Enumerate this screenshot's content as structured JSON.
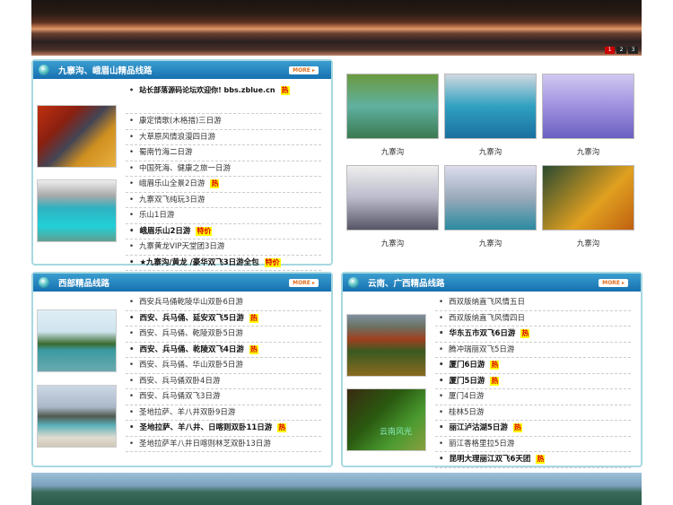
{
  "banner": {
    "pages": [
      "1",
      "2",
      "3"
    ]
  },
  "more_label": "MORE ▸",
  "hot": "热",
  "special": "特价",
  "panel1": {
    "title": "九寨沟、峨眉山精品线路",
    "items": [
      {
        "text": "站长部落源码论坛欢迎你! bbs.zblue.cn",
        "bold": true,
        "tag": "hot"
      },
      {
        "text": "康定情歌(木格措)三日游"
      },
      {
        "text": "大草原风情浪漫四日游"
      },
      {
        "text": "蜀南竹海二日游"
      },
      {
        "text": "中国死海、健康之旅一日游"
      },
      {
        "text": "峨眉乐山全景2日游",
        "tag": "hot"
      },
      {
        "text": "九寨双飞纯玩3日游"
      },
      {
        "text": "乐山1日游"
      },
      {
        "text": "峨眉乐山2日游",
        "bold": true,
        "tag": "special"
      },
      {
        "text": "九寨黄龙VIP天堂团3日游"
      },
      {
        "text": "★九寨沟/黄龙 /豪华双飞3日游全包",
        "bold": true,
        "tag": "special"
      }
    ]
  },
  "gallery": [
    "九寨沟",
    "九寨沟",
    "九寨沟",
    "九寨沟",
    "九寨沟",
    "九寨沟"
  ],
  "panel2": {
    "title": "西部精品线路",
    "items": [
      {
        "text": "西安兵马俑乾陵华山双卧6日游"
      },
      {
        "text": "西安、兵马俑、延安双飞5日游",
        "bold": true,
        "tag": "hot"
      },
      {
        "text": "西安、兵马俑、乾陵双卧5日游"
      },
      {
        "text": "西安、兵马俑、乾陵双飞4日游",
        "bold": true,
        "tag": "hot"
      },
      {
        "text": "西安、兵马俑、华山双卧5日游"
      },
      {
        "text": "西安、兵马俑双卧4日游"
      },
      {
        "text": "西安、兵马俑双飞3日游"
      },
      {
        "text": "圣地拉萨、羊八井双卧9日游"
      },
      {
        "text": "圣地拉萨、羊八井、日喀则双卧11日游",
        "bold": true,
        "tag": "hot"
      },
      {
        "text": "圣地拉萨羊八井日喀则林芝双卧13日游"
      }
    ]
  },
  "panel3": {
    "title": "云南、广西精品线路",
    "photo_caption": "云南风光",
    "items": [
      {
        "text": "西双版纳直飞风情五日"
      },
      {
        "text": "西双版纳直飞风情四日"
      },
      {
        "text": "华东五市双飞6日游",
        "bold": true,
        "tag": "hot"
      },
      {
        "text": "腾冲瑞丽双飞5日游"
      },
      {
        "text": "厦门6日游",
        "bold": true,
        "tag": "hot"
      },
      {
        "text": "厦门5日游",
        "bold": true,
        "tag": "hot"
      },
      {
        "text": "厦门4日游"
      },
      {
        "text": "桂林5日游"
      },
      {
        "text": "丽江泸沽湖5日游",
        "bold": true,
        "tag": "hot"
      },
      {
        "text": "丽江香格里拉5日游"
      },
      {
        "text": "昆明大理丽江双飞6天团",
        "bold": true,
        "tag": "hot"
      }
    ]
  }
}
